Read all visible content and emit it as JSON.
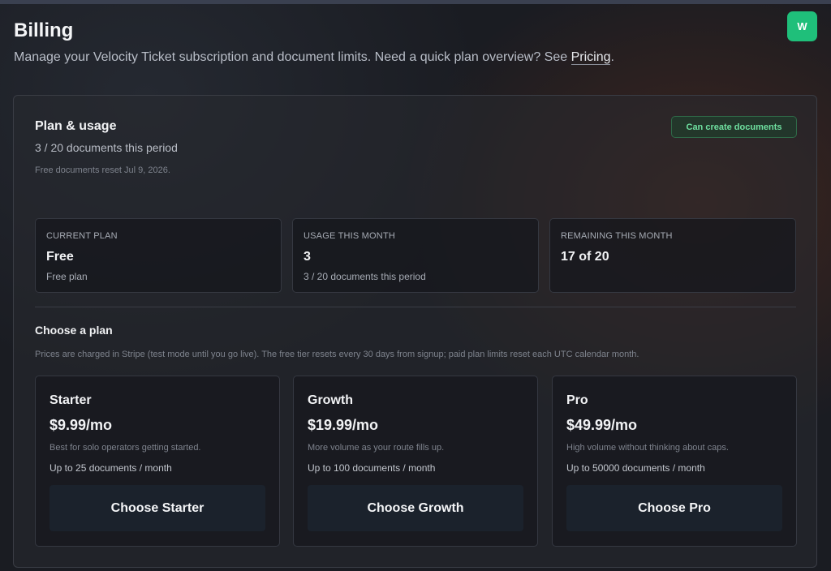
{
  "header": {
    "title": "Billing",
    "subtitle": "Manage your Velocity Ticket subscription and document limits. Need a quick plan overview? See ",
    "pricing_link": "Pricing",
    "subtitle_end": ".",
    "avatar_initial": "W"
  },
  "plan_usage": {
    "title": "Plan & usage",
    "usage": "3 / 20 documents this period",
    "reset_note": "Free documents reset Jul 9, 2026.",
    "status_badge": "Can create documents"
  },
  "stats": [
    {
      "label": "CURRENT PLAN",
      "value": "Free",
      "sub": "Free plan"
    },
    {
      "label": "USAGE THIS MONTH",
      "value": "3",
      "sub": "3 / 20 documents this period"
    },
    {
      "label": "REMAINING THIS MONTH",
      "value": "17 of 20",
      "sub": ""
    }
  ],
  "choose_plan": {
    "title": "Choose a plan",
    "note": "Prices are charged in Stripe (test mode until you go live). The free tier resets every 30 days from signup; paid plan limits reset each UTC calendar month.",
    "plans": [
      {
        "name": "Starter",
        "price": "$9.99/mo",
        "desc": "Best for solo operators getting started.",
        "limit": "Up to 25 documents / month",
        "button": "Choose Starter"
      },
      {
        "name": "Growth",
        "price": "$19.99/mo",
        "desc": "More volume as your route fills up.",
        "limit": "Up to 100 documents / month",
        "button": "Choose Growth"
      },
      {
        "name": "Pro",
        "price": "$49.99/mo",
        "desc": "High volume without thinking about caps.",
        "limit": "Up to 50000 documents / month",
        "button": "Choose Pro"
      }
    ]
  }
}
